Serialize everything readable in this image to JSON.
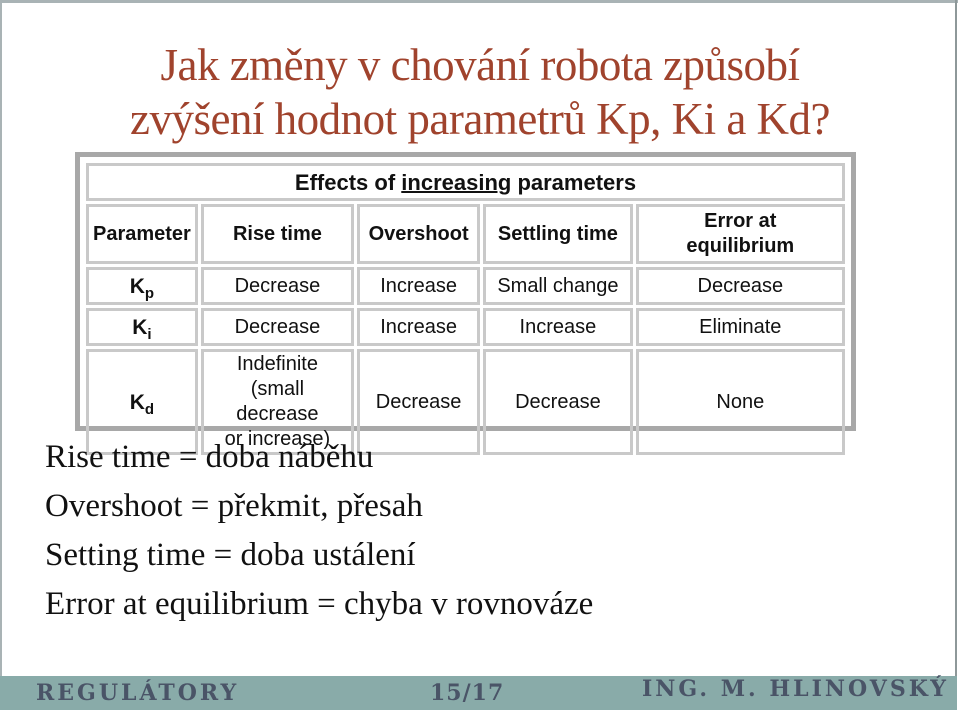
{
  "slide": {
    "title_lines": [
      "Jak změny v chování robota způsobí",
      "zvýšení hodnot parametrů Kp, Ki a Kd?"
    ],
    "colors": {
      "title": "#a0432d",
      "footer_bg": "#89aba9",
      "footer_text": "#4a5467"
    }
  },
  "table": {
    "caption_prefix": "Effects of ",
    "caption_underlined": "increasing",
    "caption_suffix": " parameters",
    "headers": [
      "Parameter",
      "Rise time",
      "Overshoot",
      "Settling time",
      "Error at equilibrium"
    ],
    "header_error_line1": "Error at",
    "header_error_line2": "equilibrium",
    "rows": [
      {
        "param_base": "K",
        "param_sub": "p",
        "cells": [
          "Decrease",
          "Increase",
          "Small change",
          "Decrease"
        ]
      },
      {
        "param_base": "K",
        "param_sub": "i",
        "cells": [
          "Decrease",
          "Increase",
          "Increase",
          "Eliminate"
        ]
      },
      {
        "param_base": "K",
        "param_sub": "d",
        "rise_line1": "Indefinite",
        "rise_line2": "(small decrease",
        "rise_line3": "or increase)",
        "cells": [
          "Indefinite (small decrease or increase)",
          "Decrease",
          "Decrease",
          "None"
        ]
      }
    ]
  },
  "definitions": [
    "Rise time = doba náběhu",
    "Overshoot = překmit, přesah",
    "Setting time = doba ustálení",
    "Error at equilibrium = chyba v rovnováze"
  ],
  "footer": {
    "left": "REGULÁTORY",
    "page": "15/17",
    "right": "ING. M. HLINOVSKÝ"
  }
}
